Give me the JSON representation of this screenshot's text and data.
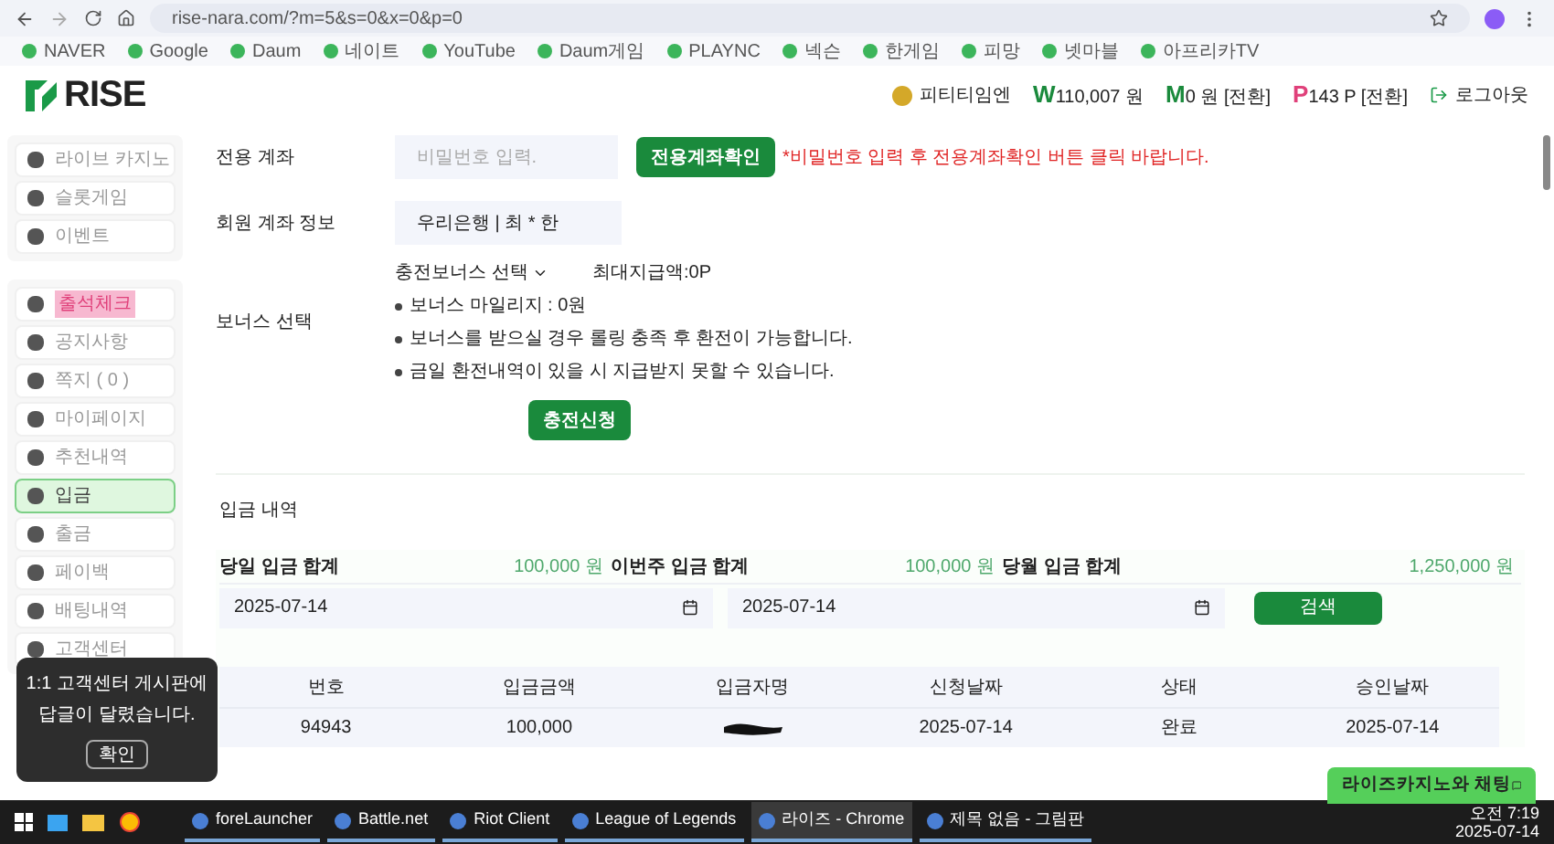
{
  "browser": {
    "url": "rise-nara.com/?m=5&s=0&x=0&p=0",
    "bookmarks": [
      "NAVER",
      "Google",
      "Daum",
      "네이트",
      "YouTube",
      "Daum게임",
      "PLAYNC",
      "넥슨",
      "한게임",
      "피망",
      "넷마블",
      "아프리카TV"
    ]
  },
  "header": {
    "logo": "RISE",
    "user": "피티티임엔",
    "balances": [
      {
        "kind": "won",
        "symbol": "W",
        "text": "110,007 원"
      },
      {
        "kind": "money",
        "symbol": "M",
        "text": "0 원 [전환]"
      },
      {
        "kind": "point",
        "symbol": "P",
        "text": "143 P [전환]"
      }
    ],
    "logout": "로그아웃"
  },
  "sidebar": {
    "groups": [
      {
        "items": [
          {
            "label": "라이브 카지노",
            "selected": false,
            "highlight": false
          },
          {
            "label": "슬롯게임",
            "selected": false,
            "highlight": false
          },
          {
            "label": "이벤트",
            "selected": false,
            "highlight": false
          }
        ]
      },
      {
        "items": [
          {
            "label": "출석체크",
            "selected": false,
            "highlight": true
          },
          {
            "label": "공지사항",
            "selected": false,
            "highlight": false
          },
          {
            "label": "쪽지 ( 0 )",
            "selected": false,
            "highlight": false
          },
          {
            "label": "마이페이지",
            "selected": false,
            "highlight": false
          },
          {
            "label": "추천내역",
            "selected": false,
            "highlight": false
          },
          {
            "label": "입금",
            "selected": true,
            "highlight": false
          },
          {
            "label": "출금",
            "selected": false,
            "highlight": false
          },
          {
            "label": "페이백",
            "selected": false,
            "highlight": false
          },
          {
            "label": "배팅내역",
            "selected": false,
            "highlight": false
          },
          {
            "label": "고객센터",
            "selected": false,
            "highlight": false
          }
        ]
      }
    ]
  },
  "form": {
    "account": {
      "label": "전용 계좌",
      "placeholder": "비밀번호 입력.",
      "button": "전용계좌확인",
      "note": "*비밀번호 입력 후 전용계좌확인 버튼 클릭 바랍니다."
    },
    "member": {
      "label": "회원 계좌 정보",
      "value": "우리은행 | 최 * 한"
    },
    "bonus": {
      "label": "보너스 선택",
      "select": "충전보너스 선택",
      "max": "최대지급액:0P",
      "notes": [
        "보너스 마일리지 : 0원",
        "보너스를 받으실 경우 롤링 충족 후 환전이 가능합니다.",
        "금일 환전내역이 있을 시 지급받지 못할 수 있습니다."
      ]
    },
    "submit": "충전신청"
  },
  "history": {
    "title": "입금 내역",
    "totals": [
      {
        "label": "당일 입금 합계",
        "value": "100,000 원"
      },
      {
        "label": "이번주 입금 합계",
        "value": "100,000 원"
      },
      {
        "label": "당월 입금 합계",
        "value": "1,250,000 원"
      }
    ],
    "from": "2025-07-14",
    "to": "2025-07-14",
    "search": "검색",
    "columns": [
      "번호",
      "입금금액",
      "입금자명",
      "신청날짜",
      "상태",
      "승인날짜"
    ],
    "rows": [
      {
        "cells": [
          "94943",
          "100,000",
          null,
          "2025-07-14",
          "완료",
          "2025-07-14"
        ]
      }
    ]
  },
  "toast": {
    "lines": [
      "1:1 고객센터 게시판에",
      "답글이 달렸습니다."
    ],
    "button": "확인"
  },
  "chat": {
    "label": "라이즈카지노와 채팅"
  },
  "taskbar": {
    "apps": [
      {
        "label": "foreLauncher",
        "selected": false
      },
      {
        "label": "Battle.net",
        "selected": false
      },
      {
        "label": "Riot Client",
        "selected": false
      },
      {
        "label": "League of Legends",
        "selected": false
      },
      {
        "label": "라이즈 - Chrome",
        "selected": true
      },
      {
        "label": "제목 없음 - 그림판",
        "selected": false
      }
    ],
    "time": "오전 7:19",
    "date": "2025-07-14"
  }
}
